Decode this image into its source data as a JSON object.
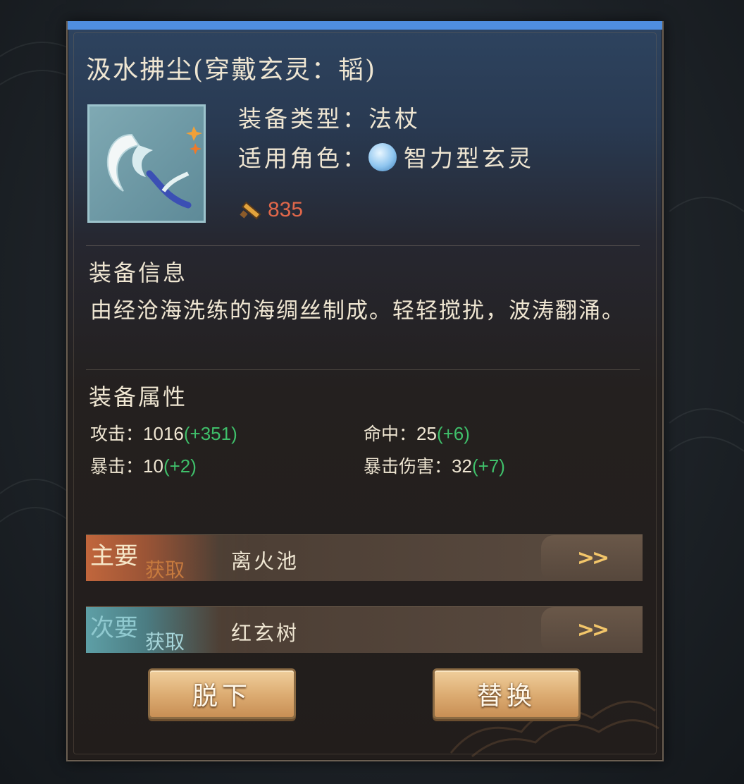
{
  "equipment": {
    "title": "汲水拂尘(穿戴玄灵：韬)",
    "type_label": "装备类型：法杖",
    "role_label": "适用角色：",
    "role_value": "智力型玄灵",
    "power_value": "835",
    "icons": {
      "item": "feather-duster-weapon-icon",
      "role": "intelligence-role-icon",
      "power": "sword-power-icon"
    }
  },
  "info": {
    "heading": "装备信息",
    "description": "由经沧海洗练的海绸丝制成。轻轻搅扰，波涛翻涌。"
  },
  "attributes": {
    "heading": "装备属性",
    "items": [
      {
        "label": "攻击：",
        "value": "1016",
        "bonus": "(+351)"
      },
      {
        "label": "命中：",
        "value": "25",
        "bonus": "(+6)"
      },
      {
        "label": "暴击：",
        "value": "10",
        "bonus": "(+2)"
      },
      {
        "label": "暴击伤害：",
        "value": "32",
        "bonus": "(+7)"
      }
    ]
  },
  "sources": [
    {
      "tag_main": "主要",
      "tag_sub": "获取",
      "name": "离火池",
      "go": ">>"
    },
    {
      "tag_main": "次要",
      "tag_sub": "获取",
      "name": "红玄树",
      "go": ">>"
    }
  ],
  "buttons": {
    "unequip": "脱下",
    "replace": "替换"
  },
  "colors": {
    "accent_blue": "#4f8ee0",
    "power_red": "#e0674a",
    "bonus_green": "#3fbf6a",
    "button_gold": "#dbaa70"
  }
}
